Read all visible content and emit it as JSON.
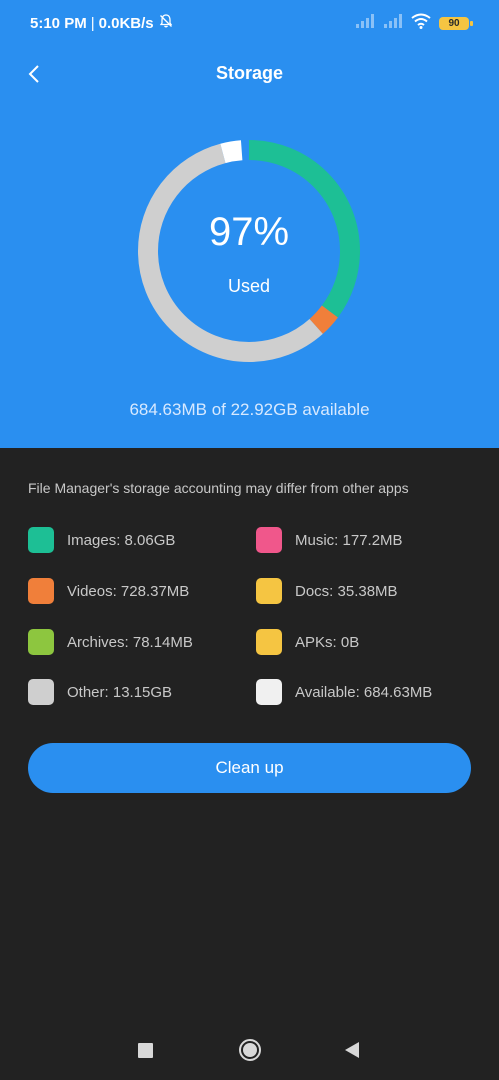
{
  "statusbar": {
    "time": "5:10 PM",
    "separator": "|",
    "speed": "0.0KB/s",
    "battery": "90",
    "icons": [
      "bell-off-icon",
      "signal-icon",
      "signal-icon",
      "wifi-icon",
      "battery-icon"
    ]
  },
  "header": {
    "title": "Storage",
    "back_icon": "chevron-left-icon"
  },
  "summary": {
    "percent": "97%",
    "used_label": "Used",
    "available_text": "684.63MB of 22.92GB available"
  },
  "ring_segments": [
    {
      "name": "Images",
      "fraction": 0.352,
      "color": "#1dbf95"
    },
    {
      "name": "Videos",
      "fraction": 0.032,
      "color": "#f07f3a"
    },
    {
      "name": "Other",
      "fraction": 0.574,
      "color": "#cfcfcf"
    },
    {
      "name": "Available",
      "fraction": 0.03,
      "color": "#ffffff"
    }
  ],
  "note": "File Manager's storage accounting may differ from other apps",
  "legend": [
    {
      "label": "Images: 8.06GB",
      "color": "#1dbf95"
    },
    {
      "label": "Music: 177.2MB",
      "color": "#f0578b"
    },
    {
      "label": "Videos: 728.37MB",
      "color": "#f07f3a"
    },
    {
      "label": "Docs: 35.38MB",
      "color": "#f5c542"
    },
    {
      "label": "Archives: 78.14MB",
      "color": "#8dc63f"
    },
    {
      "label": "APKs: 0B",
      "color": "#f5c542"
    },
    {
      "label": "Other: 13.15GB",
      "color": "#cfcfcf"
    },
    {
      "label": "Available: 684.63MB",
      "color": "#f0f0f0"
    }
  ],
  "button": {
    "label": "Clean up"
  },
  "navbar": {
    "icons": [
      "recents-square-icon",
      "home-circle-icon",
      "back-triangle-icon"
    ]
  },
  "colors": {
    "accent": "#2a8ff0",
    "background": "#222222"
  }
}
